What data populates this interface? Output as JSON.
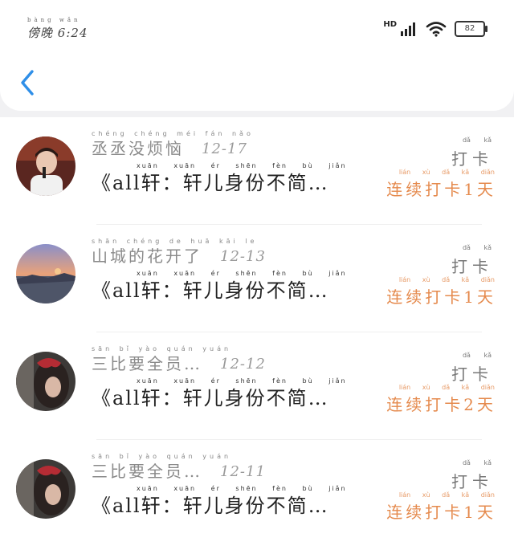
{
  "status_bar": {
    "time": "6:24",
    "time_prefix": "傍晚",
    "time_pinyin": "bàng wǎn",
    "network": "HD",
    "battery": "82"
  },
  "nav": {
    "back_icon": "chevron-left-icon"
  },
  "colors": {
    "streak": "#e58a4d",
    "accent_blue": "#2f8fe8"
  },
  "rows": [
    {
      "name": "丞丞没烦恼",
      "name_pinyin": "chéng chéng méi fán nǎo",
      "date": "12-17",
      "message": "《all轩：轩儿身份不简…",
      "message_pinyin": "xuān xuān ér shēn fèn bù jiǎn",
      "checkin": "打卡",
      "checkin_pinyin": "dǎ kǎ",
      "streak": "连续打卡1天",
      "streak_pinyin": "lián xù dǎ kǎ diǎn"
    },
    {
      "name": "山城的花开了",
      "name_pinyin": "shān chéng de huā kāi le",
      "date": "12-13",
      "message": "《all轩：轩儿身份不简…",
      "message_pinyin": "xuān xuān ér shēn fèn bù jiǎn",
      "checkin": "打卡",
      "checkin_pinyin": "dǎ kǎ",
      "streak": "连续打卡1天",
      "streak_pinyin": "lián xù dǎ kǎ diǎn"
    },
    {
      "name": "三比要全员…",
      "name_pinyin": "sān bǐ yào quán yuán",
      "date": "12-12",
      "message": "《all轩：轩儿身份不简…",
      "message_pinyin": "xuān xuān ér shēn fèn bù jiǎn",
      "checkin": "打卡",
      "checkin_pinyin": "dǎ kǎ",
      "streak": "连续打卡2天",
      "streak_pinyin": "lián xù dǎ kǎ diǎn"
    },
    {
      "name": "三比要全员…",
      "name_pinyin": "sān bǐ yào quán yuán",
      "date": "12-11",
      "message": "《all轩：轩儿身份不简…",
      "message_pinyin": "xuān xuān ér shēn fèn bù jiǎn",
      "checkin": "打卡",
      "checkin_pinyin": "dǎ kǎ",
      "streak": "连续打卡1天",
      "streak_pinyin": "lián xù dǎ kǎ diǎn"
    }
  ]
}
